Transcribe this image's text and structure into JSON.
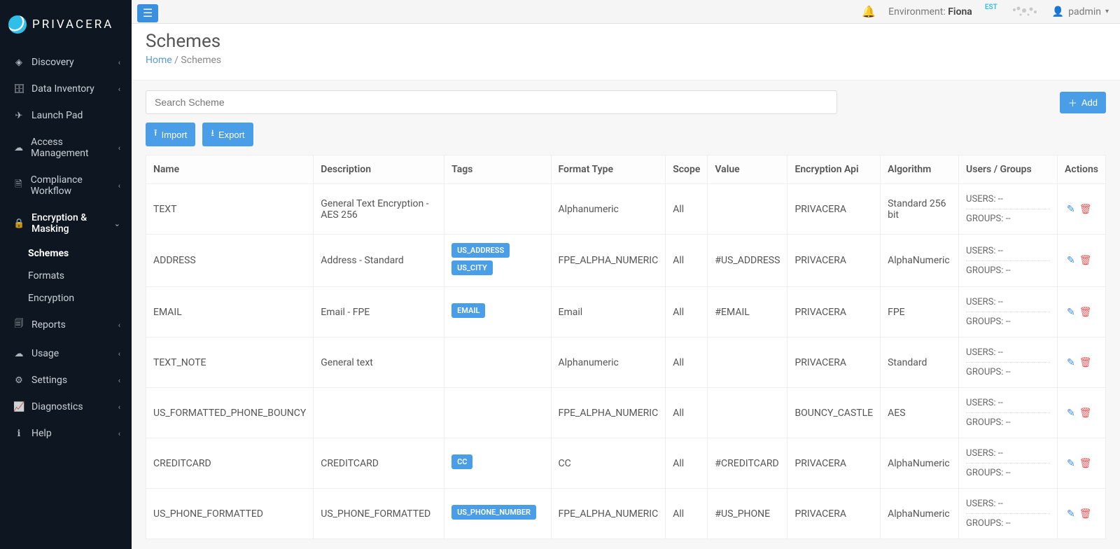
{
  "brand": "PRIVACERA",
  "topbar": {
    "env_label": "Environment:",
    "env_name": "Fiona",
    "est": "EST",
    "user": "padmin"
  },
  "sidebar": {
    "items": [
      {
        "icon": "◈",
        "label": "Discovery",
        "expandable": true
      },
      {
        "icon": "🗄",
        "label": "Data Inventory",
        "expandable": true
      },
      {
        "icon": "✈",
        "label": "Launch Pad",
        "expandable": false
      },
      {
        "icon": "☁",
        "label": "Access Management",
        "expandable": true
      },
      {
        "icon": "🗎",
        "label": "Compliance Workflow",
        "expandable": true
      },
      {
        "icon": "🔒",
        "label": "Encryption & Masking",
        "expandable": true,
        "active": true,
        "sub": [
          {
            "label": "Schemes",
            "active": true
          },
          {
            "label": "Formats"
          },
          {
            "label": "Encryption"
          }
        ]
      },
      {
        "icon": "🗐",
        "label": "Reports",
        "expandable": true
      },
      {
        "icon": "☁",
        "label": "Usage",
        "expandable": true
      },
      {
        "icon": "⚙",
        "label": "Settings",
        "expandable": true
      },
      {
        "icon": "📈",
        "label": "Diagnostics",
        "expandable": true
      },
      {
        "icon": "ℹ",
        "label": "Help",
        "expandable": true
      }
    ]
  },
  "page": {
    "title": "Schemes",
    "breadcrumb_home": "Home",
    "breadcrumb_current": "Schemes"
  },
  "toolbar": {
    "search_placeholder": "Search Scheme",
    "add_label": "Add",
    "import_label": "Import",
    "export_label": "Export"
  },
  "table": {
    "columns": [
      "Name",
      "Description",
      "Tags",
      "Format Type",
      "Scope",
      "Value",
      "Encryption Api",
      "Algorithm",
      "Users / Groups",
      "Actions"
    ],
    "rows": [
      {
        "name": "TEXT",
        "description": "General Text Encryption - AES 256",
        "tags": [],
        "format_type": "Alphanumeric",
        "scope": "All",
        "value": "",
        "encryption_api": "PRIVACERA",
        "algorithm": "Standard 256 bit",
        "users": "--",
        "groups": "--"
      },
      {
        "name": "ADDRESS",
        "description": "Address - Standard",
        "tags": [
          "US_ADDRESS",
          "US_CITY"
        ],
        "format_type": "FPE_ALPHA_NUMERIC",
        "scope": "All",
        "value": "#US_ADDRESS",
        "encryption_api": "PRIVACERA",
        "algorithm": "AlphaNumeric",
        "users": "--",
        "groups": "--"
      },
      {
        "name": "EMAIL",
        "description": "Email - FPE",
        "tags": [
          "EMAIL"
        ],
        "format_type": "Email",
        "scope": "All",
        "value": "#EMAIL",
        "encryption_api": "PRIVACERA",
        "algorithm": "FPE",
        "users": "--",
        "groups": "--"
      },
      {
        "name": "TEXT_NOTE",
        "description": "General text",
        "tags": [],
        "format_type": "Alphanumeric",
        "scope": "All",
        "value": "",
        "encryption_api": "PRIVACERA",
        "algorithm": "Standard",
        "users": "--",
        "groups": "--"
      },
      {
        "name": "US_FORMATTED_PHONE_BOUNCY",
        "description": "",
        "tags": [],
        "format_type": "FPE_ALPHA_NUMERIC",
        "scope": "All",
        "value": "",
        "encryption_api": "BOUNCY_CASTLE",
        "algorithm": "AES",
        "users": "--",
        "groups": "--"
      },
      {
        "name": "CREDITCARD",
        "description": "CREDITCARD",
        "tags": [
          "CC"
        ],
        "format_type": "CC",
        "scope": "All",
        "value": "#CREDITCARD",
        "encryption_api": "PRIVACERA",
        "algorithm": "AlphaNumeric",
        "users": "--",
        "groups": "--"
      },
      {
        "name": "US_PHONE_FORMATTED",
        "description": "US_PHONE_FORMATTED",
        "tags": [
          "US_PHONE_NUMBER"
        ],
        "format_type": "FPE_ALPHA_NUMERIC",
        "scope": "All",
        "value": "#US_PHONE",
        "encryption_api": "PRIVACERA",
        "algorithm": "AlphaNumeric",
        "users": "--",
        "groups": "--"
      }
    ],
    "users_label": "USERS:",
    "groups_label": "GROUPS:"
  }
}
